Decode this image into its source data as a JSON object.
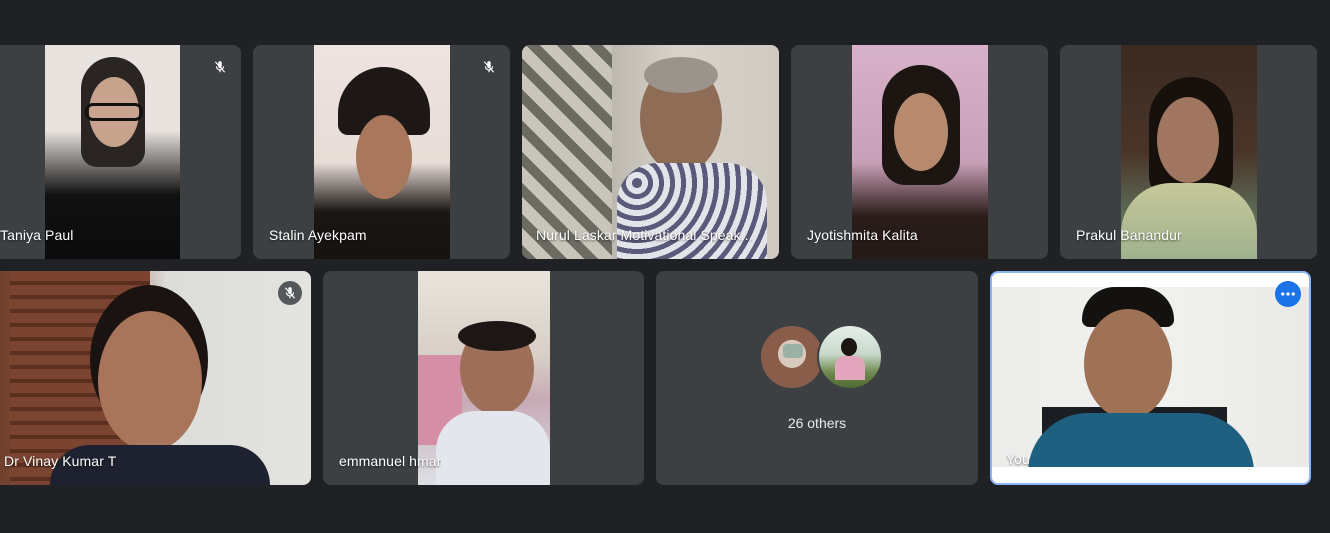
{
  "participants": [
    {
      "name": "Taniya Paul",
      "muted": true
    },
    {
      "name": "Stalin Ayekpam",
      "muted": true
    },
    {
      "name": "Nurul Laskar Motivational Speak...",
      "muted": false
    },
    {
      "name": "Jyotishmita Kalita",
      "muted": false
    },
    {
      "name": "Prakul Banandur",
      "muted": false
    },
    {
      "name": "Dr Vinay Kumar T",
      "muted": true
    },
    {
      "name": "emmanuel hmar",
      "muted": false
    },
    {
      "name": "You",
      "muted": false
    }
  ],
  "others": {
    "label": "26 others"
  },
  "icons": {
    "mute": "mic-off-icon",
    "more": "more-options-icon"
  },
  "colors": {
    "background": "#202124",
    "tile": "#3c4043",
    "active_border": "#8ab4f8",
    "accent": "#1a73e8"
  }
}
